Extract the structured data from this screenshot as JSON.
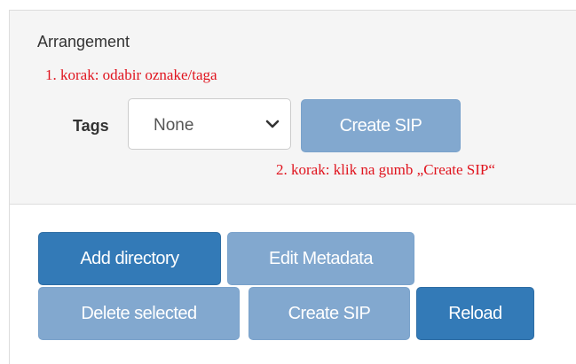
{
  "panel": {
    "heading": "Arrangement",
    "step1": "1. korak: odabir oznake/taga",
    "step2": "2. korak: klik na gumb „Create SIP“",
    "tags_label": "Tags",
    "tags_select": {
      "selected": "None",
      "icon": "chevron-down-icon"
    },
    "create_sip_label": "Create SIP"
  },
  "toolbar": {
    "add_directory": "Add directory",
    "edit_metadata": "Edit Metadata",
    "delete_selected": "Delete selected",
    "create_sip": "Create SIP",
    "reload": "Reload"
  },
  "colors": {
    "primary": "#337ab7",
    "disabled": "#82a8cf",
    "annotation": "#e0141e",
    "panel_background": "#f5f5f5"
  }
}
